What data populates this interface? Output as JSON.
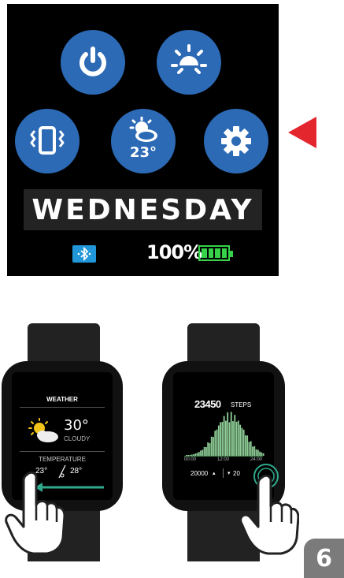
{
  "top_screen": {
    "buttons": [
      {
        "icon": "power-icon"
      },
      {
        "icon": "brightness-icon"
      },
      {
        "icon": "vibration-icon"
      },
      {
        "icon": "weather-icon",
        "label": "23°"
      },
      {
        "icon": "settings-icon"
      }
    ],
    "day": "WEDNESDAY",
    "battery_text": "100%",
    "battery_level": 1.0,
    "bluetooth_icon": "bluetooth-icon",
    "pointer_color": "#e3262e"
  },
  "weather_watch": {
    "title": "WEATHER",
    "temp": "30°",
    "condition": "CLOUDY",
    "section_label": "TEMPERATURE",
    "low": "23°",
    "high": "28°",
    "gesture": "swipe-left"
  },
  "steps_watch": {
    "steps_value": "23450",
    "steps_unit": "STEPS",
    "time_labels": [
      "00:00",
      "12:00",
      "24:00"
    ],
    "left_stat": "20000",
    "right_stat": "20",
    "gesture": "tap"
  },
  "page_number": "6",
  "colors": {
    "button_blue": "#2c6ab6",
    "battery_green": "#36d24a",
    "swipe_arrow": "#2fa98c",
    "badge_gray": "#7b7b7b"
  }
}
